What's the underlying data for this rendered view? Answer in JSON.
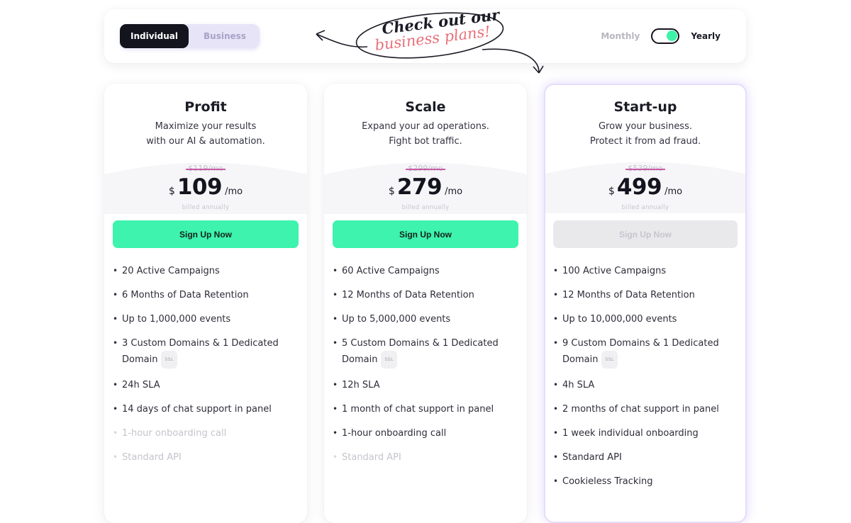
{
  "segment": {
    "individual": "Individual",
    "business": "Business"
  },
  "callout": {
    "line1": "Check out our",
    "line2": "business plans!"
  },
  "billing": {
    "monthly": "Monthly",
    "yearly": "Yearly",
    "selected": "Yearly"
  },
  "colors": {
    "accent_green": "#3df3ae",
    "dark": "#14141f",
    "strike": "#c85aa6",
    "highlight_border": "#e6ddfa"
  },
  "plans": [
    {
      "name": "Profit",
      "desc1": "Maximize your results",
      "desc2": "with our AI & automation.",
      "old_price": "$119/mo",
      "currency": "$",
      "amount": "109",
      "per": "/mo",
      "billed": "billed annually",
      "cta": "Sign Up Now",
      "features": [
        {
          "text": "20 Active Campaigns",
          "muted": false
        },
        {
          "text": "6 Months of Data Retention",
          "muted": false
        },
        {
          "text": "Up to 1,000,000 events",
          "muted": false
        },
        {
          "text": "3 Custom Domains & 1 Dedicated Domain",
          "muted": false,
          "badge": "SSL"
        },
        {
          "text": "24h SLA",
          "muted": false
        },
        {
          "text": "14 days of chat support in panel",
          "muted": false
        },
        {
          "text": "1-hour onboarding call",
          "muted": true
        },
        {
          "text": "Standard API",
          "muted": true
        }
      ]
    },
    {
      "name": "Scale",
      "desc1": "Expand your ad operations.",
      "desc2": "Fight bot traffic.",
      "old_price": "$299/mo",
      "currency": "$",
      "amount": "279",
      "per": "/mo",
      "billed": "billed annually",
      "cta": "Sign Up Now",
      "features": [
        {
          "text": "60 Active Campaigns",
          "muted": false
        },
        {
          "text": "12 Months of Data Retention",
          "muted": false
        },
        {
          "text": "Up to 5,000,000 events",
          "muted": false
        },
        {
          "text": "5 Custom Domains & 1 Dedicated Domain",
          "muted": false,
          "badge": "SSL"
        },
        {
          "text": "12h SLA",
          "muted": false
        },
        {
          "text": "1 month of chat support in panel",
          "muted": false
        },
        {
          "text": "1-hour onboarding call",
          "muted": false
        },
        {
          "text": "Standard API",
          "muted": true
        }
      ]
    },
    {
      "name": "Start-up",
      "desc1": "Grow your business.",
      "desc2": "Protect it from ad fraud.",
      "old_price": "$539/mo",
      "currency": "$",
      "amount": "499",
      "per": "/mo",
      "billed": "billed annually",
      "cta": "Sign Up Now",
      "features": [
        {
          "text": "100 Active Campaigns",
          "muted": false
        },
        {
          "text": "12 Months of Data Retention",
          "muted": false
        },
        {
          "text": "Up to 10,000,000 events",
          "muted": false
        },
        {
          "text": "9 Custom Domains & 1 Dedicated Domain",
          "muted": false,
          "badge": "SSL"
        },
        {
          "text": "4h SLA",
          "muted": false
        },
        {
          "text": "2 months of chat support in panel",
          "muted": false
        },
        {
          "text": "1 week individual onboarding",
          "muted": false
        },
        {
          "text": "Standard API",
          "muted": false
        },
        {
          "text": "Cookieless Tracking",
          "muted": false
        }
      ]
    }
  ]
}
